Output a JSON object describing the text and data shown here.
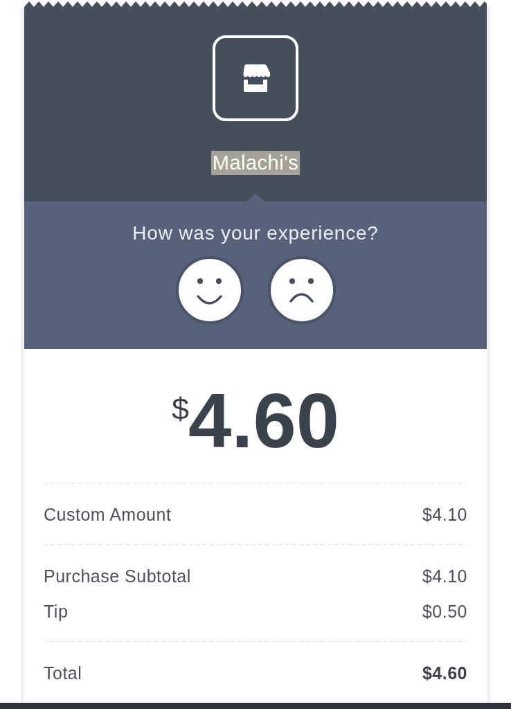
{
  "receipt": {
    "merchant": {
      "name": "Malachi's",
      "highlighted": true
    },
    "feedback": {
      "question": "How was your experience?",
      "options": [
        {
          "kind": "happy",
          "selected": false
        },
        {
          "kind": "sad",
          "selected": false
        }
      ]
    },
    "amount": {
      "currency": "$",
      "value": "4.60"
    },
    "sections": [
      {
        "rows": [
          {
            "label": "Custom Amount",
            "value": "$4.10",
            "bold": false
          }
        ]
      },
      {
        "rows": [
          {
            "label": "Purchase Subtotal",
            "value": "$4.10",
            "bold": false
          },
          {
            "label": "Tip",
            "value": "$0.50",
            "bold": false
          }
        ]
      },
      {
        "rows": [
          {
            "label": "Total",
            "value": "$4.60",
            "bold": true
          }
        ]
      }
    ]
  }
}
